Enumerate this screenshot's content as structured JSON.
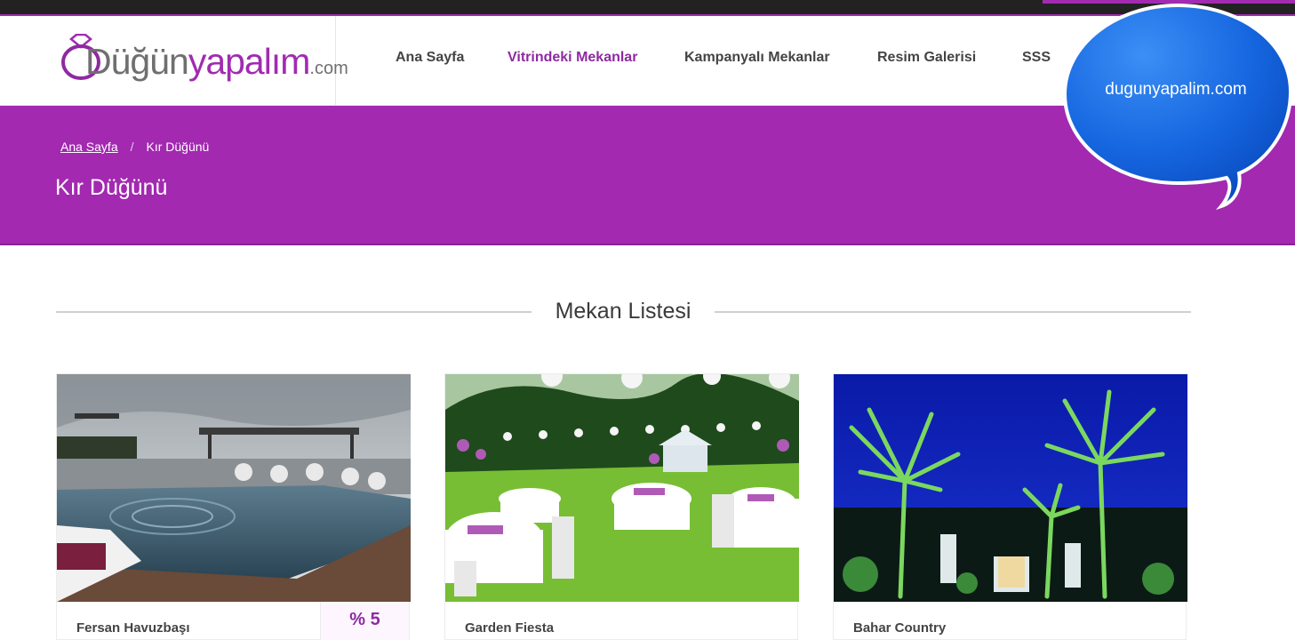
{
  "brand": {
    "logo_parts": [
      "Düğün",
      "yapalım",
      ".com"
    ],
    "accent": "#a229b0",
    "dark": "#222222"
  },
  "nav": {
    "items": [
      {
        "label": "Ana Sayfa",
        "active": false
      },
      {
        "label": "Vitrindeki Mekanlar",
        "active": true
      },
      {
        "label": "Kampanyalı Mekanlar",
        "active": false
      },
      {
        "label": "Resim Galerisi",
        "active": false
      },
      {
        "label": "SSS",
        "active": false
      }
    ]
  },
  "banner": {
    "breadcrumb": {
      "home": "Ana Sayfa",
      "separator": "/",
      "current": "Kır Düğünü"
    },
    "title": "Kır Düğünü"
  },
  "bubble": {
    "text": "dugunyapalim.com"
  },
  "section": {
    "title": "Mekan Listesi"
  },
  "venues": [
    {
      "name": "Fersan Havuzbaşı",
      "badge": "% 5",
      "image": "poolside-venue-photo"
    },
    {
      "name": "Garden Fiesta",
      "badge": "",
      "image": "garden-tables-photo"
    },
    {
      "name": "Bahar Country",
      "badge": "",
      "image": "night-palm-garden-photo"
    }
  ]
}
